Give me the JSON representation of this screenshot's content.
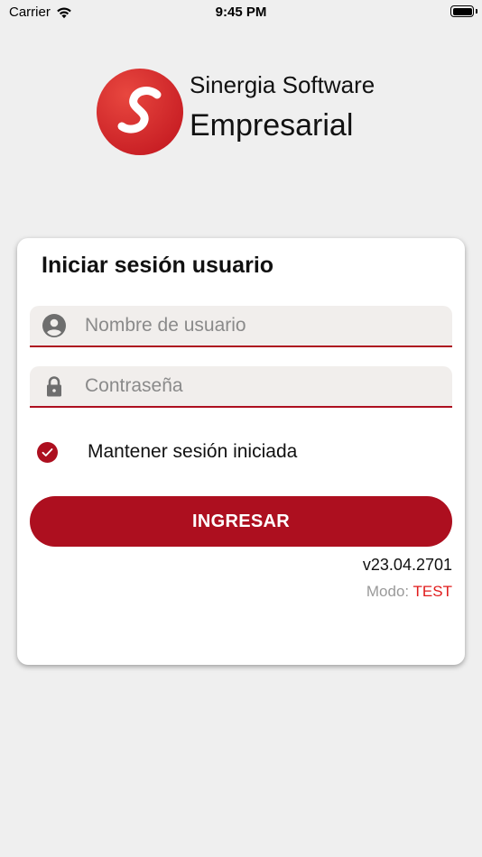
{
  "status_bar": {
    "carrier": "Carrier",
    "time": "9:45 PM",
    "battery_level": 1.0
  },
  "brand": {
    "logo_letter": "S",
    "line1": "Sinergia Software",
    "line2": "Empresarial",
    "accent_color": "#ad0f1f",
    "logo_color": "#d9282c"
  },
  "login_card": {
    "title": "Iniciar sesión usuario",
    "username": {
      "value": "",
      "placeholder": "Nombre de usuario",
      "icon": "user-icon"
    },
    "password": {
      "value": "",
      "placeholder": "Contraseña",
      "icon": "lock-icon"
    },
    "remember": {
      "label": "Mantener sesión iniciada",
      "checked": true
    },
    "submit_label": "INGRESAR",
    "version": "v23.04.2701",
    "mode_label": "Modo:",
    "mode_value": "TEST"
  }
}
